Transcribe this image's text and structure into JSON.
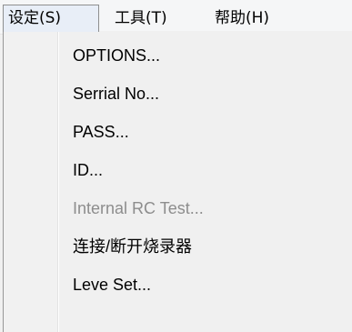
{
  "menubar": {
    "items": [
      {
        "label": "设定(S)"
      },
      {
        "label": "工具(T)"
      },
      {
        "label": "帮助(H)"
      }
    ]
  },
  "dropdown": {
    "items": [
      {
        "label": "OPTIONS...",
        "enabled": true
      },
      {
        "label": "Serrial No...",
        "enabled": true
      },
      {
        "label": "PASS...",
        "enabled": true
      },
      {
        "label": "ID...",
        "enabled": true
      },
      {
        "label": "Internal RC Test...",
        "enabled": false
      },
      {
        "label": "连接/断开烧录器",
        "enabled": true
      },
      {
        "label": "Leve Set...",
        "enabled": true
      }
    ]
  }
}
